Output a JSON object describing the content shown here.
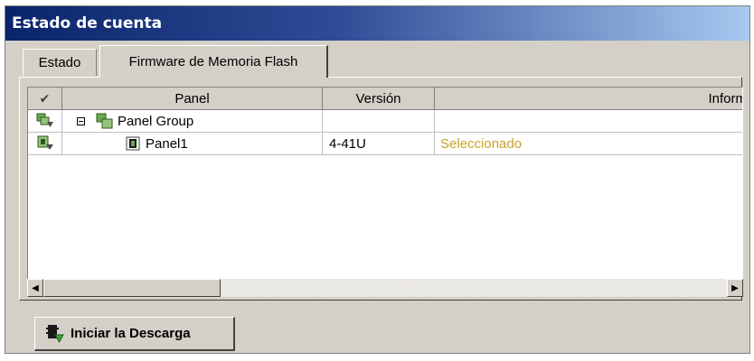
{
  "window": {
    "title": "Estado de cuenta"
  },
  "tabs": [
    {
      "label": "Estado",
      "active": false
    },
    {
      "label": "Firmware de Memoria Flash",
      "active": true
    }
  ],
  "grid": {
    "columns": {
      "check": "✔",
      "panel": "Panel",
      "version": "Versión",
      "info": "Inform"
    },
    "rows": [
      {
        "panel": "Panel Group",
        "version": "",
        "info": "",
        "expanded": true,
        "icon": "panel-group-icon"
      },
      {
        "panel": "Panel1",
        "version": "4-41U",
        "info": "Seleccionado",
        "icon": "panel-chip-icon"
      }
    ]
  },
  "scrollbar": {
    "left_arrow": "◀",
    "right_arrow": "▶"
  },
  "download_button": {
    "label": "Iniciar la Descarga"
  },
  "colors": {
    "title_start": "#0a246a",
    "title_end": "#a6caf0",
    "status_selected": "#c9a227",
    "surface": "#d4d0c8"
  }
}
